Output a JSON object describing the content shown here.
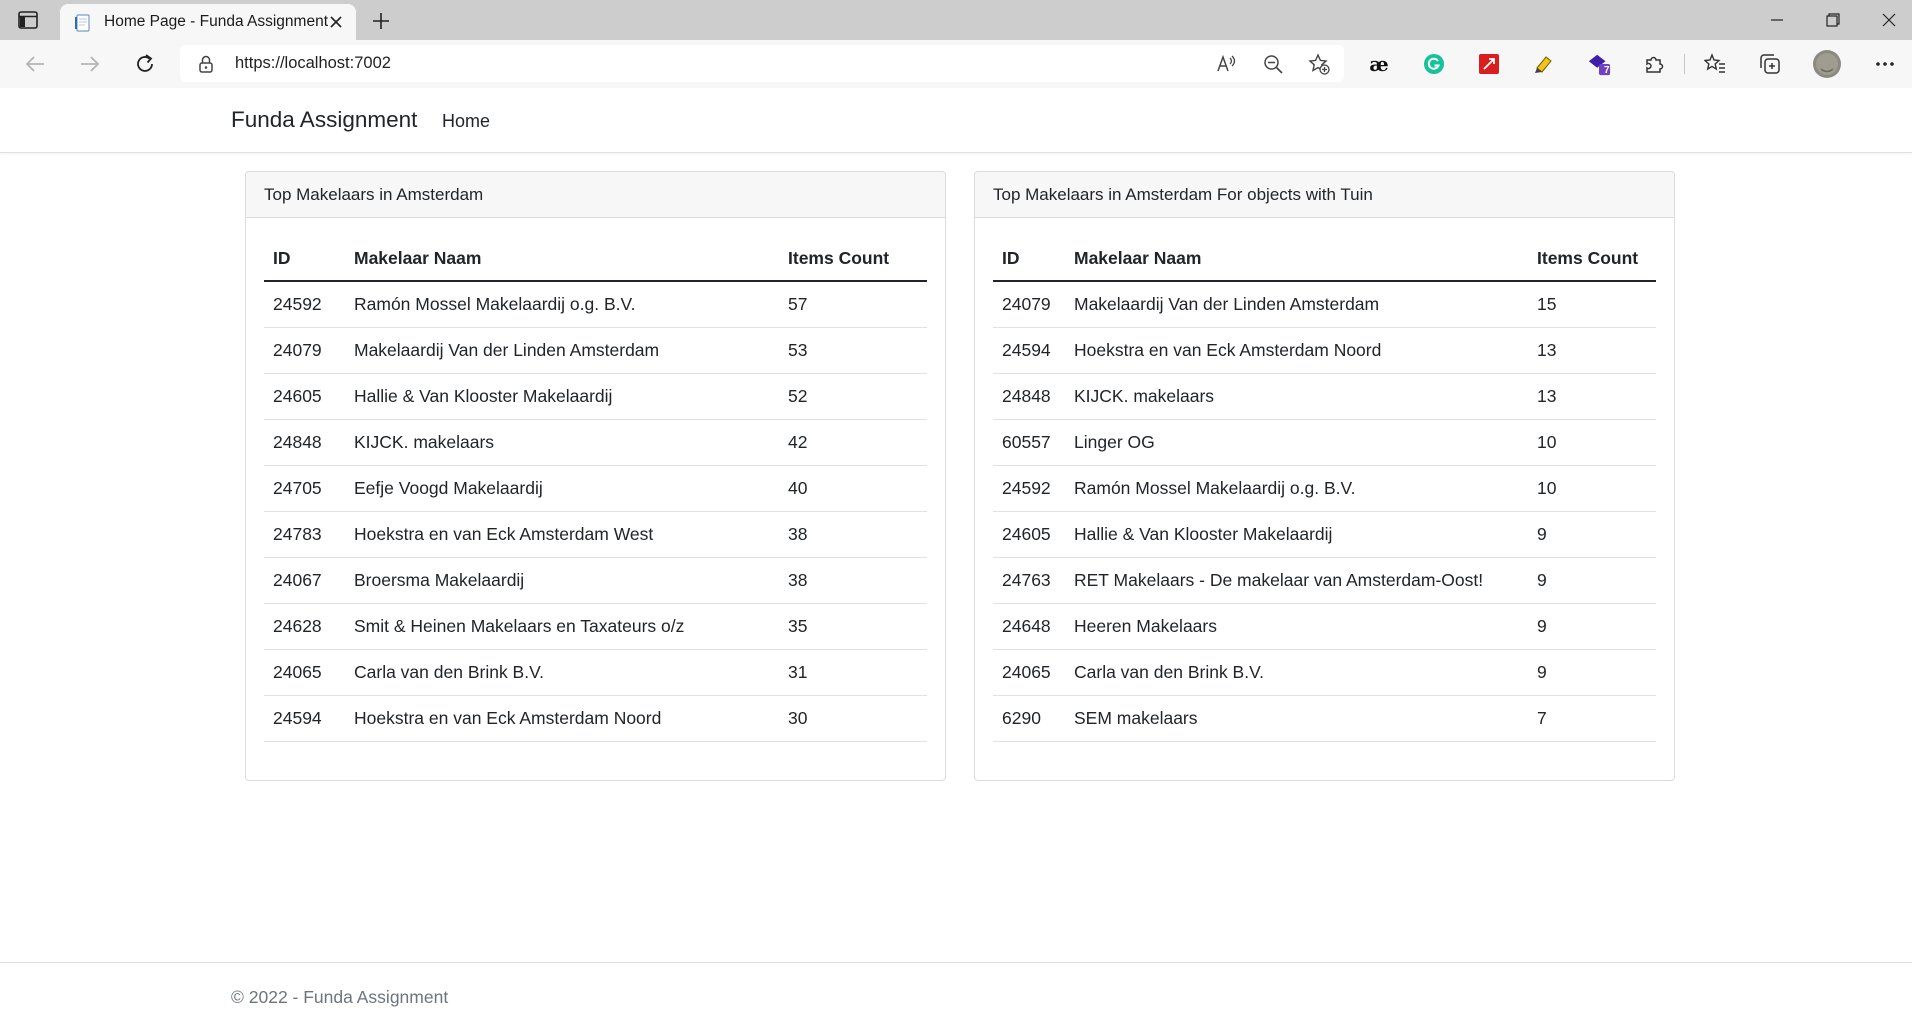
{
  "browser": {
    "tab_title": "Home Page - Funda Assignment",
    "url": "https://localhost:7002",
    "extension_badge": "7"
  },
  "navbar": {
    "brand": "Funda Assignment",
    "links": [
      "Home"
    ]
  },
  "tables": [
    {
      "title": "Top Makelaars in Amsterdam",
      "columns": [
        "ID",
        "Makelaar Naam",
        "Items Count"
      ],
      "rows": [
        [
          "24592",
          "Ramón Mossel Makelaardij o.g. B.V.",
          "57"
        ],
        [
          "24079",
          "Makelaardij Van der Linden Amsterdam",
          "53"
        ],
        [
          "24605",
          "Hallie & Van Klooster Makelaardij",
          "52"
        ],
        [
          "24848",
          "KIJCK. makelaars",
          "42"
        ],
        [
          "24705",
          "Eefje Voogd Makelaardij",
          "40"
        ],
        [
          "24783",
          "Hoekstra en van Eck Amsterdam West",
          "38"
        ],
        [
          "24067",
          "Broersma Makelaardij",
          "38"
        ],
        [
          "24628",
          "Smit & Heinen Makelaars en Taxateurs o/z",
          "35"
        ],
        [
          "24065",
          "Carla van den Brink B.V.",
          "31"
        ],
        [
          "24594",
          "Hoekstra en van Eck Amsterdam Noord",
          "30"
        ]
      ]
    },
    {
      "title": "Top Makelaars in Amsterdam For objects with Tuin",
      "columns": [
        "ID",
        "Makelaar Naam",
        "Items Count"
      ],
      "rows": [
        [
          "24079",
          "Makelaardij Van der Linden Amsterdam",
          "15"
        ],
        [
          "24594",
          "Hoekstra en van Eck Amsterdam Noord",
          "13"
        ],
        [
          "24848",
          "KIJCK. makelaars",
          "13"
        ],
        [
          "60557",
          "Linger OG",
          "10"
        ],
        [
          "24592",
          "Ramón Mossel Makelaardij o.g. B.V.",
          "10"
        ],
        [
          "24605",
          "Hallie & Van Klooster Makelaardij",
          "9"
        ],
        [
          "24763",
          "RET Makelaars - De makelaar van Amsterdam-Oost!",
          "9"
        ],
        [
          "24648",
          "Heeren Makelaars",
          "9"
        ],
        [
          "24065",
          "Carla van den Brink B.V.",
          "9"
        ],
        [
          "6290",
          "SEM makelaars",
          "7"
        ]
      ]
    }
  ],
  "footer": {
    "text": "© 2022 - Funda Assignment"
  }
}
